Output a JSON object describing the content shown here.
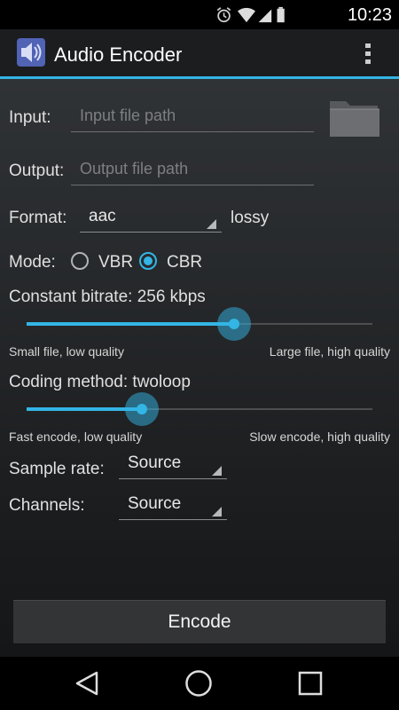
{
  "status_bar": {
    "time": "10:23",
    "icons": [
      "alarm-icon",
      "wifi-icon",
      "signal-icon",
      "battery-icon"
    ]
  },
  "action_bar": {
    "title": "Audio Encoder",
    "icon": "app-icon",
    "menu_icon": "overflow-menu-icon"
  },
  "form": {
    "input": {
      "label": "Input:",
      "placeholder": "Input file path",
      "value": ""
    },
    "output": {
      "label": "Output:",
      "placeholder": "Output file path",
      "value": ""
    },
    "browse_icon": "folder-icon",
    "format": {
      "label": "Format:",
      "value": "aac",
      "note": "lossy"
    },
    "mode": {
      "label": "Mode:",
      "options": [
        {
          "label": "VBR",
          "checked": false
        },
        {
          "label": "CBR",
          "checked": true
        }
      ]
    },
    "bitrate": {
      "label": "Constant bitrate: 256 kbps",
      "level": 0.6,
      "min_hint": "Small file, low quality",
      "max_hint": "Large file, high quality"
    },
    "coding": {
      "label": "Coding method: twoloop",
      "level": 0.333,
      "min_hint": "Fast encode, low quality",
      "max_hint": "Slow encode, high quality"
    },
    "sample_rate": {
      "label": "Sample rate:",
      "value": "Source"
    },
    "channels": {
      "label": "Channels:",
      "value": "Source"
    }
  },
  "encode_button": "Encode",
  "nav_bar": {
    "back_icon": "back-icon",
    "home_icon": "home-icon",
    "recents_icon": "recents-icon"
  },
  "colors": {
    "accent": "#33b5e5",
    "background": "#1f2123"
  }
}
